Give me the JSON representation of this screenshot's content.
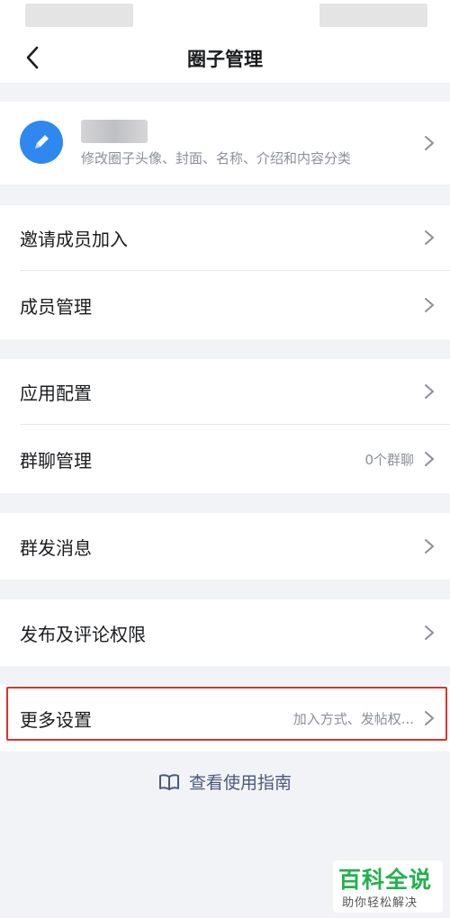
{
  "header": {
    "title": "圈子管理"
  },
  "circle_info": {
    "description": "修改圈子头像、封面、名称、介绍和内容分类"
  },
  "menu": {
    "invite_label": "邀请成员加入",
    "members_label": "成员管理",
    "app_config_label": "应用配置",
    "group_chat_label": "群聊管理",
    "group_chat_hint": "0个群聊",
    "broadcast_label": "群发消息",
    "permissions_label": "发布及评论权限",
    "more_settings_label": "更多设置",
    "more_settings_hint": "加入方式、发帖权..."
  },
  "guide": {
    "label": "查看使用指南"
  },
  "watermark": {
    "main": "百科全说",
    "sub": "助你轻松解决"
  },
  "colors": {
    "accent": "#2e88f0",
    "highlight": "#e0322b",
    "background": "#f2f3f7",
    "watermark": "#22b14c"
  },
  "icons": [
    "back-arrow-icon",
    "edit-pen-icon",
    "chevron-right-icon",
    "book-icon"
  ]
}
